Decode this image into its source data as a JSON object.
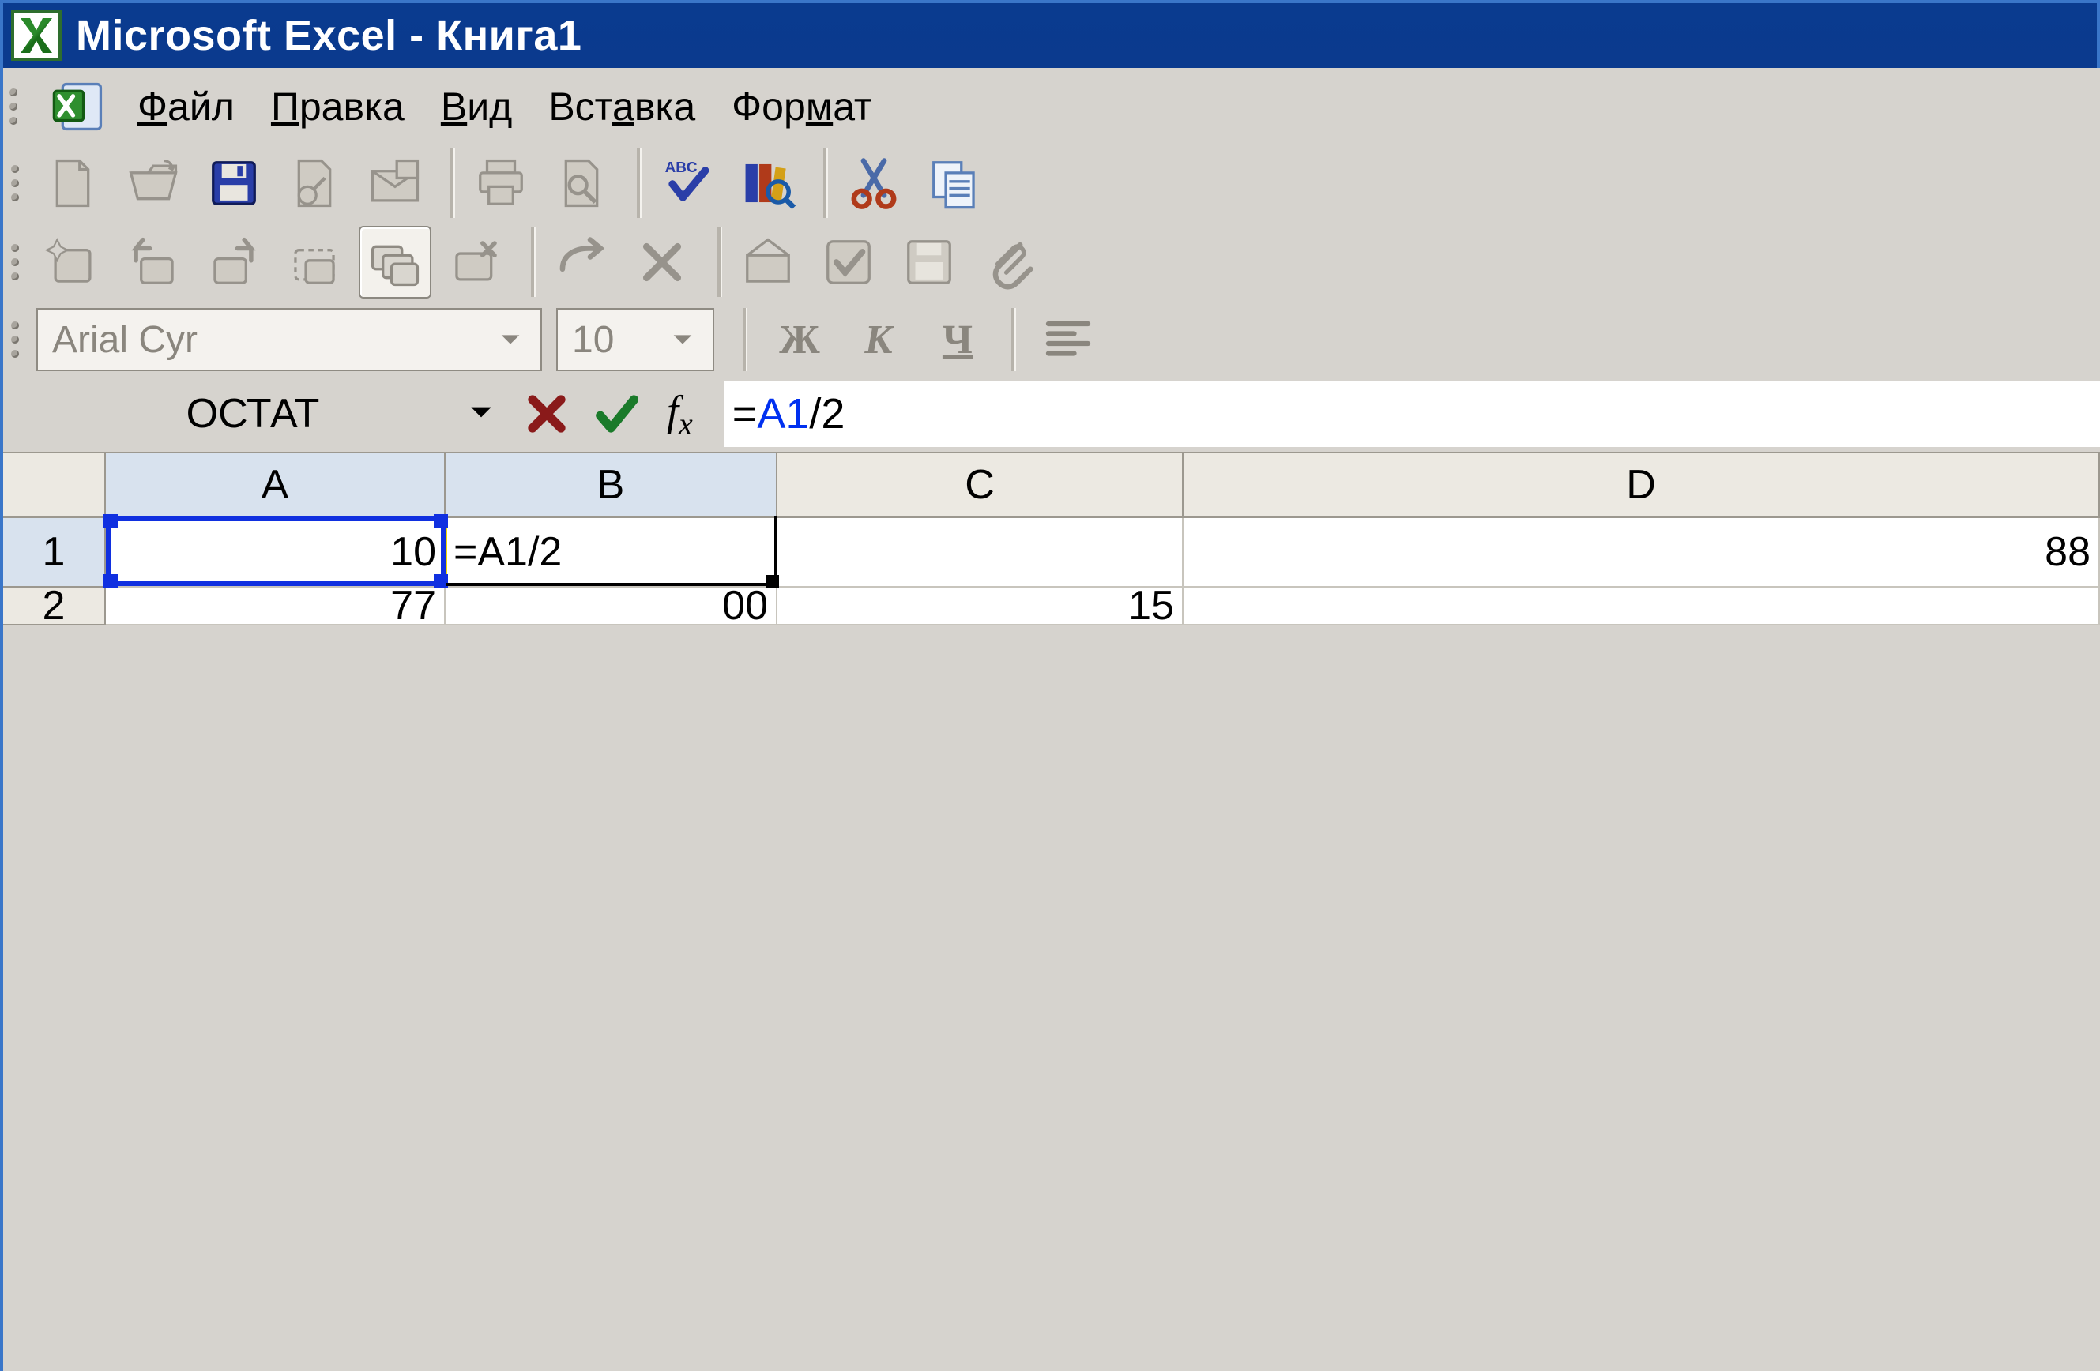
{
  "title": "Microsoft Excel - Книга1",
  "menu": {
    "file": {
      "label": "Файл",
      "u": "Ф"
    },
    "edit": {
      "label": "Правка",
      "u": "П"
    },
    "view": {
      "label": "Вид",
      "u": "В"
    },
    "insert": {
      "label": "Вставка",
      "u": "а"
    },
    "format": {
      "label": "Формат",
      "u": "м"
    }
  },
  "toolbar1": {
    "spell_label": "ABC"
  },
  "fmt": {
    "font_name": "Arial Cyr",
    "font_size": "10",
    "bold": "Ж",
    "italic": "К",
    "underline": "Ч"
  },
  "formula": {
    "name_box": "ОСТАТ",
    "fx": "fx",
    "prefix": "=",
    "ref": "A1",
    "suffix": "/2"
  },
  "grid": {
    "cols": [
      "A",
      "B",
      "C",
      "D"
    ],
    "rows": [
      "1",
      "2"
    ],
    "A1": "10",
    "B1": "=A1/2",
    "C1": "",
    "D1": "88",
    "A2": "77",
    "B2": "00",
    "C2": "15"
  }
}
